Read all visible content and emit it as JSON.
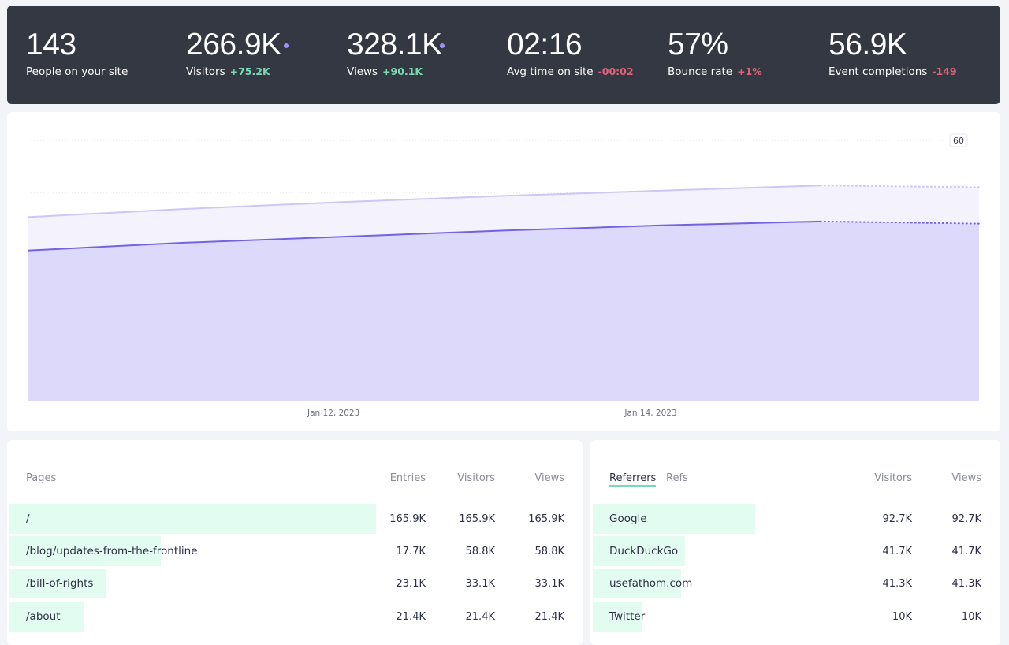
{
  "stats": [
    {
      "value": "143",
      "label": "People on your site",
      "delta": "",
      "delta_type": "",
      "dot": false
    },
    {
      "value": "266.9K",
      "label": "Visitors",
      "delta": "+75.2K",
      "delta_type": "pos",
      "dot": true
    },
    {
      "value": "328.1K",
      "label": "Views",
      "delta": "+90.1K",
      "delta_type": "pos",
      "dot": true
    },
    {
      "value": "02:16",
      "label": "Avg time on site",
      "delta": "-00:02",
      "delta_type": "neg",
      "dot": false
    },
    {
      "value": "57%",
      "label": "Bounce rate",
      "delta": "+1%",
      "delta_type": "neg",
      "dot": false
    },
    {
      "value": "56.9K",
      "label": "Event completions",
      "delta": "-149",
      "delta_type": "neg",
      "dot": false
    }
  ],
  "colors": {
    "visitors": "#7264e0",
    "visitors_fill": "#ddd9fa",
    "views": "#cdc6f6",
    "views_fill": "#f4f2fd",
    "positive": "#7ad9b3",
    "negative": "#e0627a",
    "row_bar": "#e3fcf2"
  },
  "chart_data": {
    "type": "area",
    "x": [
      "2023-01-11",
      "2023-01-12",
      "2023-01-13",
      "2023-01-14",
      "2023-01-15",
      "2023-01-16"
    ],
    "x_tick_labels": [
      "Jan 12, 2023",
      "Jan 14, 2023"
    ],
    "y_ticks": [
      12,
      24,
      36,
      48,
      60
    ],
    "ylim": [
      0,
      60
    ],
    "series": [
      {
        "key": "views",
        "values": [
          42.3,
          44.2,
          45.8,
          47.2,
          48.4,
          49.6,
          49.2
        ]
      },
      {
        "key": "visitors",
        "values": [
          34.6,
          36.4,
          37.8,
          39.2,
          40.4,
          41.3,
          40.8
        ]
      }
    ],
    "grid": true,
    "legend": "none"
  },
  "pages": {
    "title": "Pages",
    "columns": [
      "Entries",
      "Visitors",
      "Views"
    ],
    "rows": [
      {
        "label": "/",
        "entries": "165.9K",
        "visitors": "165.9K",
        "views": "165.9K",
        "share": 1.0
      },
      {
        "label": "/blog/updates-from-the-frontline",
        "entries": "17.7K",
        "visitors": "58.8K",
        "views": "58.8K",
        "share": 0.413
      },
      {
        "label": "/bill-of-rights",
        "entries": "23.1K",
        "visitors": "33.1K",
        "views": "33.1K",
        "share": 0.265
      },
      {
        "label": "/about",
        "entries": "21.4K",
        "visitors": "21.4K",
        "views": "21.4K",
        "share": 0.204
      }
    ]
  },
  "referrers": {
    "tabs": [
      "Referrers",
      "Refs"
    ],
    "columns": [
      "Visitors",
      "Views"
    ],
    "rows": [
      {
        "label": "Google",
        "visitors": "92.7K",
        "views": "92.7K",
        "share": 1.0
      },
      {
        "label": "DuckDuckGo",
        "visitors": "41.7K",
        "views": "41.7K",
        "share": 0.567
      },
      {
        "label": "usefathom.com",
        "visitors": "41.3K",
        "views": "41.3K",
        "share": 0.542
      },
      {
        "label": "Twitter",
        "visitors": "10K",
        "views": "10K",
        "share": 0.3
      }
    ]
  }
}
